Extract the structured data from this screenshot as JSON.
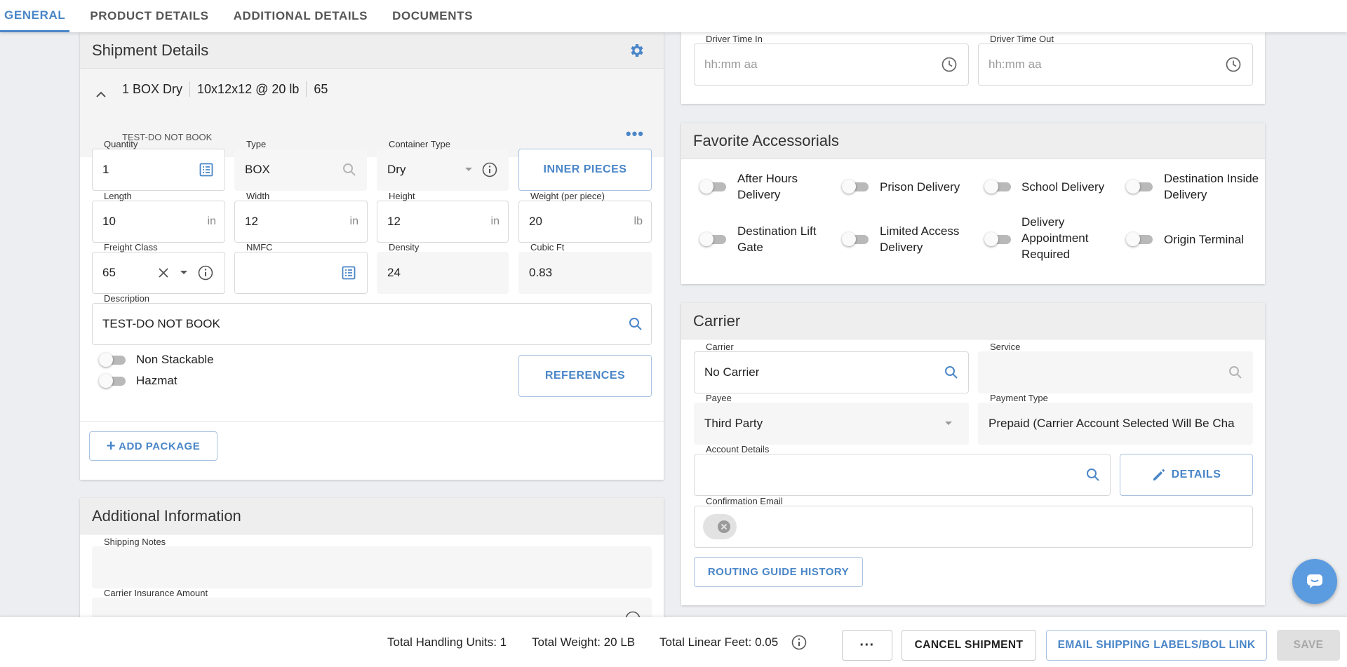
{
  "tabs": [
    {
      "label": "GENERAL"
    },
    {
      "label": "PRODUCT DETAILS"
    },
    {
      "label": "ADDITIONAL DETAILS"
    },
    {
      "label": "DOCUMENTS"
    }
  ],
  "shipment": {
    "title": "Shipment Details",
    "summary": {
      "pkg": "1 BOX Dry",
      "dims": "10x12x12 @ 20 lb",
      "class": "65",
      "desc": "TEST-DO NOT BOOK"
    },
    "fields": {
      "quantity": {
        "label": "Quantity",
        "value": "1"
      },
      "type": {
        "label": "Type",
        "value": "BOX"
      },
      "container_type": {
        "label": "Container Type",
        "value": "Dry"
      },
      "length": {
        "label": "Length",
        "value": "10",
        "unit": "in"
      },
      "width": {
        "label": "Width",
        "value": "12",
        "unit": "in"
      },
      "height": {
        "label": "Height",
        "value": "12",
        "unit": "in"
      },
      "weight": {
        "label": "Weight (per piece)",
        "value": "20",
        "unit": "lb"
      },
      "freight_class": {
        "label": "Freight Class",
        "value": "65"
      },
      "nmfc": {
        "label": "NMFC",
        "value": ""
      },
      "density": {
        "label": "Density",
        "value": "24"
      },
      "cubic_ft": {
        "label": "Cubic Ft",
        "value": "0.83"
      },
      "description": {
        "label": "Description",
        "value": "TEST-DO NOT BOOK"
      }
    },
    "inner_pieces": "INNER PIECES",
    "references": "REFERENCES",
    "non_stackable": "Non Stackable",
    "hazmat": "Hazmat",
    "add_package": "ADD PACKAGE"
  },
  "additional": {
    "title": "Additional Information",
    "shipping_notes": "Shipping Notes",
    "insurance": "Carrier Insurance Amount"
  },
  "driver": {
    "time_in": {
      "label": "Driver Time In",
      "placeholder": "hh:mm aa"
    },
    "time_out": {
      "label": "Driver Time Out",
      "placeholder": "hh:mm aa"
    }
  },
  "accessorials": {
    "title": "Favorite Accessorials",
    "items": [
      {
        "label": "After Hours Delivery"
      },
      {
        "label": "Prison Delivery"
      },
      {
        "label": "School Delivery"
      },
      {
        "label": "Destination Inside Delivery"
      },
      {
        "label": "Destination Lift Gate"
      },
      {
        "label": "Limited Access Delivery"
      },
      {
        "label": "Delivery Appointment Required"
      },
      {
        "label": "Origin Terminal"
      }
    ]
  },
  "carrier": {
    "title": "Carrier",
    "carrier": {
      "label": "Carrier",
      "value": "No Carrier"
    },
    "service": {
      "label": "Service",
      "value": ""
    },
    "payee": {
      "label": "Payee",
      "value": "Third Party"
    },
    "payment_type": {
      "label": "Payment Type",
      "value": "Prepaid (Carrier Account Selected Will Be Cha"
    },
    "account_details": {
      "label": "Account Details",
      "value": ""
    },
    "details_btn": "DETAILS",
    "confirmation_email": {
      "label": "Confirmation Email"
    },
    "routing_guide": "ROUTING GUIDE HISTORY"
  },
  "footer": {
    "handling_units": "Total Handling Units: 1",
    "total_weight": "Total Weight: 20 LB",
    "linear_feet": "Total Linear Feet: 0.05",
    "more": "···",
    "cancel": "CANCEL SHIPMENT",
    "email_labels": "EMAIL SHIPPING LABELS/BOL LINK",
    "save": "SAVE"
  },
  "colors": {
    "accent": "#4a86c8",
    "chat_button": "#5b9be0"
  }
}
